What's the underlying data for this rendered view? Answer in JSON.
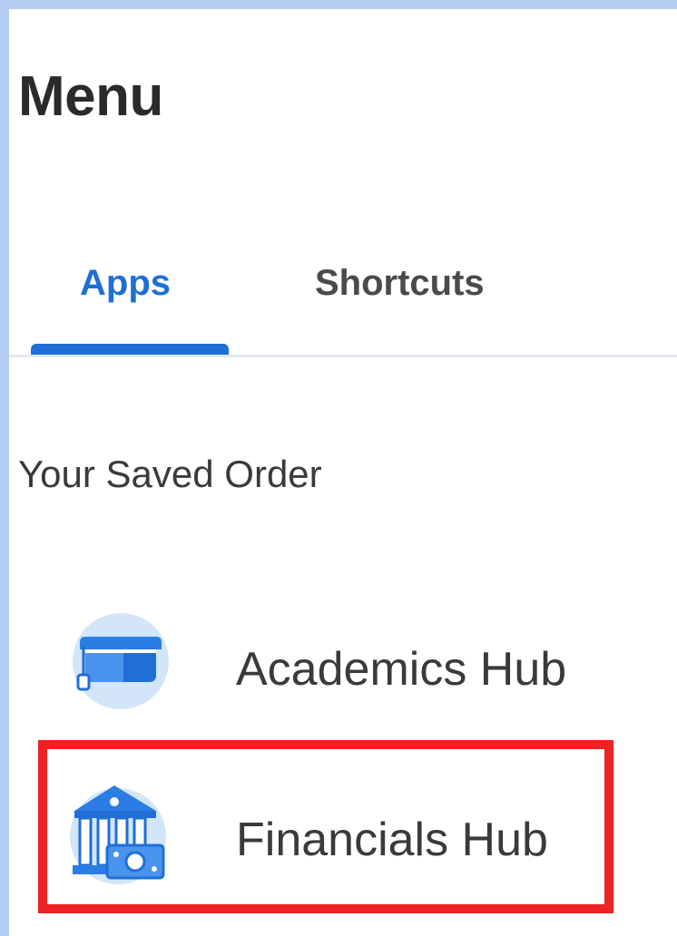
{
  "menu": {
    "title": "Menu"
  },
  "tabs": [
    {
      "label": "Apps",
      "selected": true
    },
    {
      "label": "Shortcuts",
      "selected": false
    }
  ],
  "section": {
    "label": "Your Saved Order"
  },
  "apps": [
    {
      "label": "Academics Hub",
      "icon": "graduation-cap-icon"
    },
    {
      "label": "Financials Hub",
      "icon": "bank-money-icon"
    }
  ],
  "colors": {
    "accent": "#1f6fd6",
    "highlight": "#ee2222",
    "icon_bg": "#d3e5f8",
    "frame": "#b3cdf0"
  }
}
